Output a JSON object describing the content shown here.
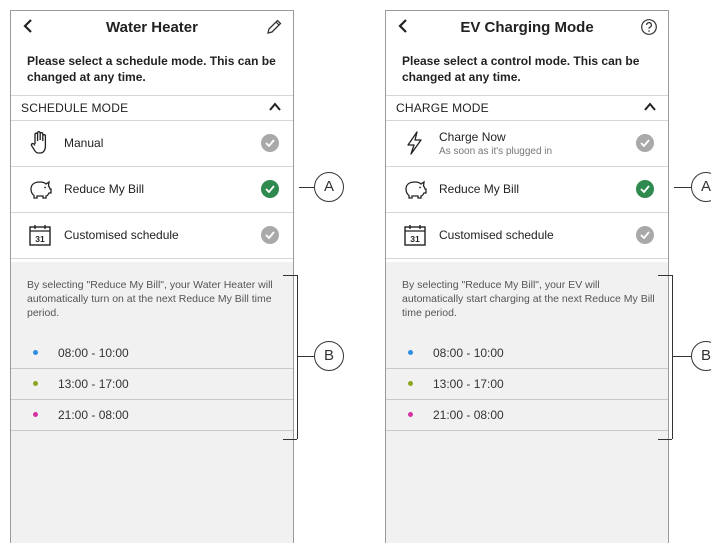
{
  "panel1": {
    "title": "Water Heater",
    "header_icon": "pencil-icon",
    "intro": "Please select a schedule mode. This can be changed at any time.",
    "section_label": "SCHEDULE MODE",
    "options": [
      {
        "label": "Manual",
        "icon": "hand-icon",
        "selected": false
      },
      {
        "label": "Reduce My Bill",
        "icon": "piggy-bank-icon",
        "selected": true
      },
      {
        "label": "Customised schedule",
        "icon": "calendar-icon",
        "selected": false
      }
    ],
    "info": "By selecting \"Reduce My Bill\", your Water Heater will automatically turn on at the next Reduce My Bill time period.",
    "times": [
      {
        "label": "08:00 - 10:00",
        "color": "#2f8ee0"
      },
      {
        "label": "13:00 - 17:00",
        "color": "#8aa61f"
      },
      {
        "label": "21:00 - 08:00",
        "color": "#d633a0"
      }
    ]
  },
  "panel2": {
    "title": "EV Charging Mode",
    "header_icon": "help-circle-icon",
    "intro": "Please select a control mode. This can be changed at any time.",
    "section_label": "CHARGE MODE",
    "options": [
      {
        "label": "Charge Now",
        "sublabel": "As soon as it's plugged in",
        "icon": "lightning-icon",
        "selected": false
      },
      {
        "label": "Reduce My Bill",
        "icon": "piggy-bank-icon",
        "selected": true
      },
      {
        "label": "Customised schedule",
        "icon": "calendar-icon",
        "selected": false
      }
    ],
    "info": "By selecting \"Reduce My Bill\", your EV will automatically start charging at the next Reduce My Bill time period.",
    "times": [
      {
        "label": "08:00 - 10:00",
        "color": "#2f8ee0"
      },
      {
        "label": "13:00 - 17:00",
        "color": "#8aa61f"
      },
      {
        "label": "21:00 - 08:00",
        "color": "#d633a0"
      }
    ]
  },
  "callouts": {
    "a": "A",
    "b": "B"
  },
  "calendar_day": "31",
  "colors": {
    "selected_check": "#2e8a4e",
    "unselected_check": "#a9a9a9",
    "info_bg": "#f1f1f1"
  }
}
